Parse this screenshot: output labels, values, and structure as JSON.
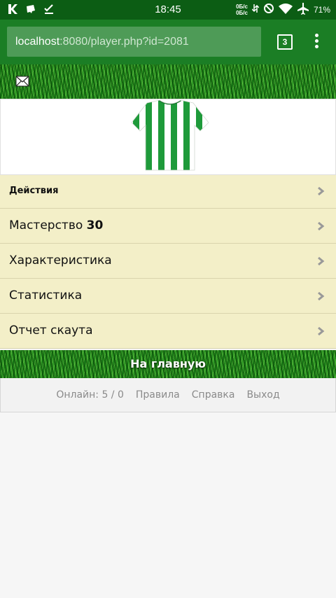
{
  "status_bar": {
    "time": "18:45",
    "net_speed_up": "0Б/с",
    "net_speed_down": "0Б/с",
    "battery": "71%",
    "icons": [
      "k-app-icon",
      "chat-icon",
      "check-icon",
      "data-arrows-icon",
      "blocked-icon",
      "wifi-icon",
      "airplane-icon"
    ]
  },
  "browser": {
    "url_host": "localhost",
    "url_rest": ":8080/player.php?id=2081",
    "tab_count": "3"
  },
  "menu": {
    "actions_label": "Действия",
    "mastery_label": "Мастерство",
    "mastery_value": "30",
    "characteristics_label": "Характеристика",
    "statistics_label": "Статистика",
    "scout_report_label": "Отчет скаута"
  },
  "home_label": "На главную",
  "footer": {
    "online": "Онлайн: 5 / 0",
    "rules": "Правила",
    "help": "Справка",
    "logout": "Выход"
  },
  "colors": {
    "status_bar": "#0c5d14",
    "browser_bar": "#1b7e25",
    "menu_item_bg": "#f3efc8",
    "jersey_green": "#1e9a3a"
  }
}
